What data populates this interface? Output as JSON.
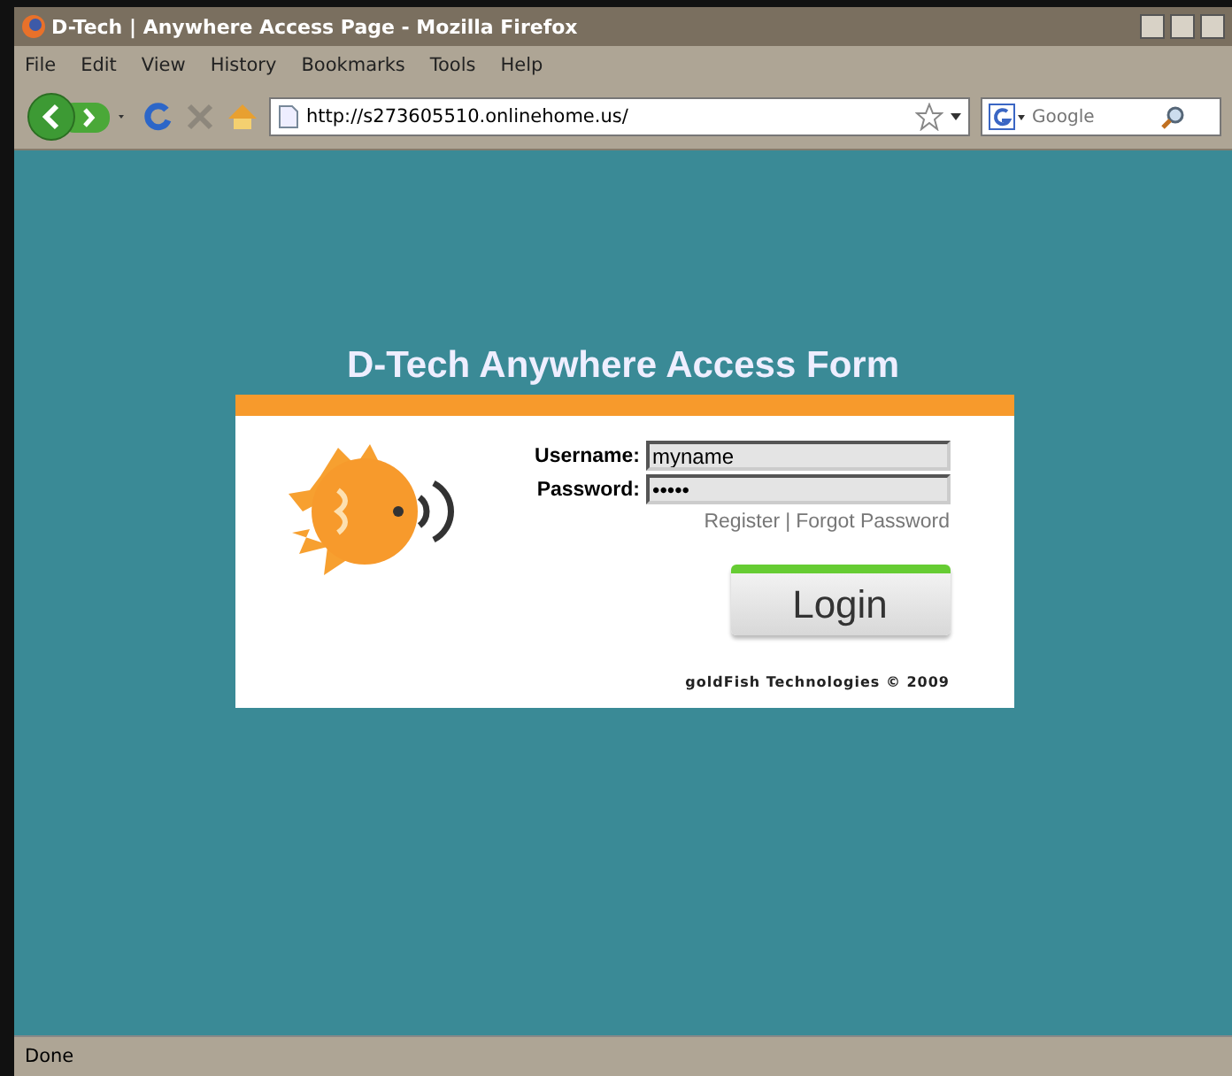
{
  "window": {
    "title": "D-Tech | Anywhere Access Page - Mozilla Firefox"
  },
  "menu": [
    {
      "label": "File"
    },
    {
      "label": "Edit"
    },
    {
      "label": "View"
    },
    {
      "label": "History"
    },
    {
      "label": "Bookmarks"
    },
    {
      "label": "Tools"
    },
    {
      "label": "Help"
    }
  ],
  "toolbar": {
    "address": "http://s273605510.onlinehome.us/",
    "search_placeholder": "Google"
  },
  "form": {
    "title": "D-Tech Anywhere Access Form",
    "fields": [
      {
        "label": "Username:",
        "value": "myname"
      },
      {
        "label": "Password:",
        "value": "•••••"
      }
    ],
    "links": [
      "Register",
      "Forgot Password"
    ],
    "separator": "|",
    "login": "Login",
    "footer": "goldFish Technologies © 2009"
  },
  "status_bar": {
    "text": "Done"
  }
}
